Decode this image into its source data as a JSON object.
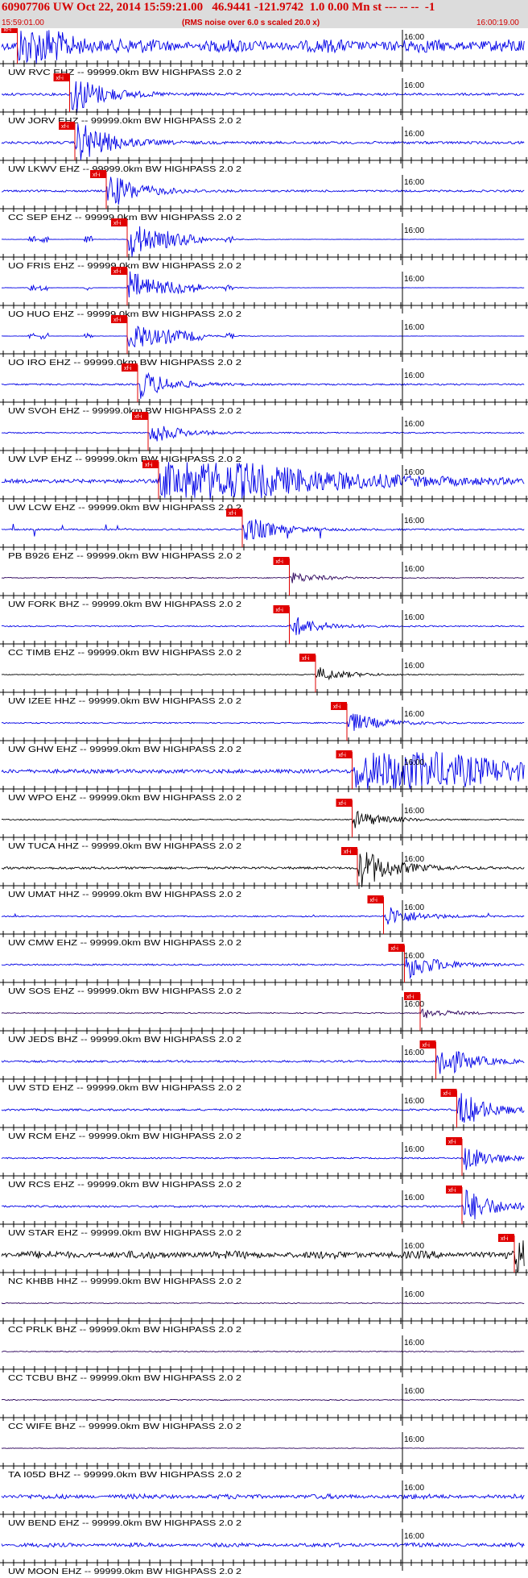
{
  "header": {
    "title": "60907706 UW Oct 22, 2014 15:59:21.00   46.9441 -121.9742  1.0 0.00 Mn st --- -- --  -1",
    "start_time": "15:59:01.00",
    "note": "(RMS noise over 6.0 s scaled 20.0 x)",
    "end_time": "16:00:19.00"
  },
  "pick_marker_label": "xf-i",
  "minute_label": "16:00",
  "colors": {
    "header_bg": "#dcdcdc",
    "title": "#d40000",
    "pick": "#e00000",
    "trace_blue": "#0000e6",
    "trace_black": "#000000",
    "trace_purple": "#2a005a",
    "axis": "#000000"
  },
  "traces": [
    {
      "label": "UW RVC EHZ -- 99999.0km BW  HIGHPASS  2.0  2",
      "color": "blue",
      "pick": 0.03,
      "amp": 0.95,
      "style": "dense"
    },
    {
      "label": "UW JORV EHZ -- 99999.0km BW  HIGHPASS  2.0  2",
      "color": "blue",
      "pick": 0.13,
      "amp": 0.6,
      "style": "event"
    },
    {
      "label": "UW LKWV EHZ -- 99999.0km BW  HIGHPASS  2.0  2",
      "color": "blue",
      "pick": 0.14,
      "amp": 0.65,
      "style": "event"
    },
    {
      "label": "CC SEP EHZ -- 99999.0km BW  HIGHPASS  2.0  2",
      "color": "blue",
      "pick": 0.2,
      "amp": 0.5,
      "style": "event"
    },
    {
      "label": "UO FRIS EHZ -- 99999.0km BW  HIGHPASS  2.0  2",
      "color": "blue",
      "pick": 0.24,
      "amp": 0.55,
      "style": "bursts"
    },
    {
      "label": "UO HUO EHZ -- 99999.0km BW  HIGHPASS  2.0  2",
      "color": "blue",
      "pick": 0.24,
      "amp": 0.5,
      "style": "bursts"
    },
    {
      "label": "UO IRO EHZ -- 99999.0km BW  HIGHPASS  2.0  2",
      "color": "blue",
      "pick": 0.24,
      "amp": 0.5,
      "style": "bursts"
    },
    {
      "label": "UW SVOH EHZ -- 99999.0km BW  HIGHPASS  2.0  2",
      "color": "blue",
      "pick": 0.26,
      "amp": 0.4,
      "style": "event"
    },
    {
      "label": "UW LVP EHZ -- 99999.0km BW  HIGHPASS  2.0  2",
      "color": "blue",
      "pick": 0.28,
      "amp": 0.3,
      "style": "event"
    },
    {
      "label": "UW LCW EHZ -- 99999.0km BW  HIGHPASS  2.0  2",
      "color": "blue",
      "pick": 0.3,
      "amp": 0.95,
      "style": "big"
    },
    {
      "label": "PB B926 EHZ -- 99999.0km BW  HIGHPASS  2.0  2",
      "color": "blue",
      "pick": 0.46,
      "amp": 0.4,
      "style": "spikes"
    },
    {
      "label": "UW FORK BHZ -- 99999.0km BW  HIGHPASS  2.0  2",
      "color": "purple",
      "pick": 0.55,
      "amp": 0.15,
      "style": "noise"
    },
    {
      "label": "CC TIMB EHZ -- 99999.0km BW  HIGHPASS  2.0  2",
      "color": "blue",
      "pick": 0.55,
      "amp": 0.3,
      "style": "event"
    },
    {
      "label": "UW IZEE HHZ -- 99999.0km BW  HIGHPASS  2.0  2",
      "color": "black",
      "pick": 0.6,
      "amp": 0.2,
      "style": "event"
    },
    {
      "label": "UW GHW EHZ -- 99999.0km BW  HIGHPASS  2.0  2",
      "color": "blue",
      "pick": 0.66,
      "amp": 0.3,
      "style": "event"
    },
    {
      "label": "UW WPO EHZ -- 99999.0km BW  HIGHPASS  2.0  2",
      "color": "blue",
      "pick": 0.67,
      "amp": 0.95,
      "style": "big"
    },
    {
      "label": "UW TUCA HHZ -- 99999.0km BW  HIGHPASS  2.0  2",
      "color": "black",
      "pick": 0.67,
      "amp": 0.25,
      "style": "event"
    },
    {
      "label": "UW UMAT HHZ -- 99999.0km BW  HIGHPASS  2.0  2",
      "color": "black",
      "pick": 0.68,
      "amp": 0.6,
      "style": "event"
    },
    {
      "label": "UW CMW EHZ -- 99999.0km BW  HIGHPASS  2.0  2",
      "color": "blue",
      "pick": 0.73,
      "amp": 0.3,
      "style": "spikes"
    },
    {
      "label": "UW SOS EHZ -- 99999.0km BW  HIGHPASS  2.0  2",
      "color": "blue",
      "pick": 0.77,
      "amp": 0.4,
      "style": "event"
    },
    {
      "label": "UW JEDS BHZ -- 99999.0km BW  HIGHPASS  2.0  2",
      "color": "purple",
      "pick": 0.8,
      "amp": 0.15,
      "style": "noise"
    },
    {
      "label": "UW STD EHZ -- 99999.0km BW  HIGHPASS  2.0  2",
      "color": "blue",
      "pick": 0.83,
      "amp": 0.5,
      "style": "event"
    },
    {
      "label": "UW RCM EHZ -- 99999.0km BW  HIGHPASS  2.0  2",
      "color": "blue",
      "pick": 0.87,
      "amp": 0.5,
      "style": "event"
    },
    {
      "label": "UW RCS EHZ -- 99999.0km BW  HIGHPASS  2.0  2",
      "color": "blue",
      "pick": 0.88,
      "amp": 0.35,
      "style": "event"
    },
    {
      "label": "UW STAR EHZ -- 99999.0km BW  HIGHPASS  2.0  2",
      "color": "blue",
      "pick": 0.88,
      "amp": 0.5,
      "style": "event"
    },
    {
      "label": "NC KHBB HHZ -- 99999.0km BW  HIGHPASS  2.0  2",
      "color": "black",
      "pick": 0.98,
      "amp": 0.55,
      "style": "dense"
    },
    {
      "label": "CC PRLK BHZ -- 99999.0km BW  HIGHPASS  2.0  2",
      "color": "purple",
      "pick": null,
      "amp": 0.15,
      "style": "noise"
    },
    {
      "label": "CC TCBU BHZ -- 99999.0km BW  HIGHPASS  2.0  2",
      "color": "purple",
      "pick": null,
      "amp": 0.15,
      "style": "noise"
    },
    {
      "label": "CC WIFE BHZ -- 99999.0km BW  HIGHPASS  2.0  2",
      "color": "purple",
      "pick": null,
      "amp": 0.15,
      "style": "noise"
    },
    {
      "label": "TA I05D BHZ -- 99999.0km BW  HIGHPASS  2.0  2",
      "color": "purple",
      "pick": null,
      "amp": 0.1,
      "style": "noise"
    },
    {
      "label": "UW BEND EHZ -- 99999.0km BW  HIGHPASS  2.0  2",
      "color": "blue",
      "pick": null,
      "amp": 0.35,
      "style": "dense"
    },
    {
      "label": "UW MOON EHZ -- 99999.0km BW  HIGHPASS  2.0  2",
      "color": "blue",
      "pick": null,
      "amp": 0.3,
      "style": "dense"
    }
  ]
}
